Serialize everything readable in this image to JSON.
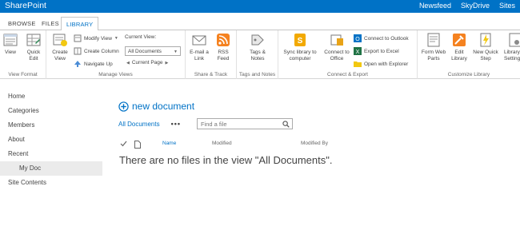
{
  "suitebar": {
    "brand": "SharePoint",
    "links": [
      "Newsfeed",
      "SkyDrive",
      "Sites"
    ]
  },
  "tabs": [
    {
      "label": "BROWSE",
      "active": false
    },
    {
      "label": "FILES",
      "active": false
    },
    {
      "label": "LIBRARY",
      "active": true
    }
  ],
  "ribbon": {
    "view_format": {
      "label": "View Format",
      "view": "View",
      "quick_edit": "Quick Edit"
    },
    "manage_views": {
      "label": "Manage Views",
      "create_view": "Create View",
      "modify_view": "Modify View",
      "create_column": "Create Column",
      "navigate_up": "Navigate Up",
      "current_view_label": "Current View:",
      "current_view_value": "All Documents",
      "current_page": "Current Page"
    },
    "share_track": {
      "label": "Share & Track",
      "email_link": "E-mail a Link",
      "rss_feed": "RSS Feed"
    },
    "tags_notes": {
      "label": "Tags and Notes",
      "tags_notes": "Tags & Notes"
    },
    "connect_export": {
      "label": "Connect & Export",
      "sync_library": "Sync library to computer",
      "connect_office": "Connect to Office",
      "connect_outlook": "Connect to Outlook",
      "export_excel": "Export to Excel",
      "open_explorer": "Open with Explorer"
    },
    "customize_library": {
      "label": "Customize Library",
      "form_web_parts": "Form Web Parts",
      "edit_library": "Edit Library",
      "new_quick_step": "New Quick Step",
      "library_settings": "Library Settings"
    }
  },
  "leftnav": [
    "Home",
    "Categories",
    "Members",
    "About",
    "Recent",
    "My Doc",
    "Site Contents"
  ],
  "main": {
    "new_document": "new document",
    "view_link": "All Documents",
    "ellipsis": "•••",
    "search_placeholder": "Find a file",
    "columns": [
      "Name",
      "Modified",
      "Modified By"
    ],
    "empty_message": "There are no files in the view \"All Documents\"."
  },
  "colors": {
    "accent": "#0072c6",
    "text": "#444444"
  }
}
